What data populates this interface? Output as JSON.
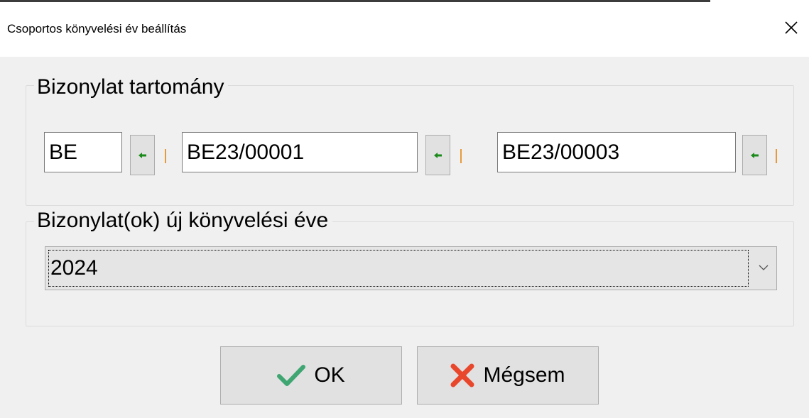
{
  "window": {
    "title": "Csoportos könyvelési év beállítás"
  },
  "range_group": {
    "caption": "Bizonylat tartomány",
    "prefix": "BE",
    "from": "BE23/00001",
    "to": "BE23/00003",
    "arrow_icon": "arrow-left-icon",
    "arrow_color": "#1a8a1a"
  },
  "year_group": {
    "caption": "Bizonylat(ok) új könyvelési éve",
    "selected_year": "2024"
  },
  "buttons": {
    "ok_label": "OK",
    "ok_icon": "checkmark-icon",
    "ok_icon_color": "#3fa672",
    "cancel_label": "Mégsem",
    "cancel_icon": "x-mark-icon",
    "cancel_icon_color": "#e8472c"
  }
}
